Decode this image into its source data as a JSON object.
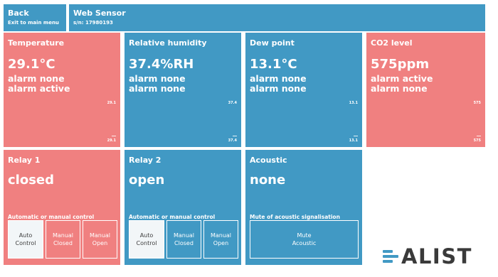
{
  "header": {
    "back_label": "Back",
    "back_sub": "Exit to main menu",
    "device_title": "Web Sensor",
    "serial": "s/n: 17980193"
  },
  "tiles": [
    {
      "title": "Temperature",
      "value": "29.1°C",
      "alarm1": "alarm none",
      "alarm2": "alarm active",
      "small_top": "29.1",
      "small_bottom": "29.1",
      "color": "#f08080"
    },
    {
      "title": "Relative humidity",
      "value": "37.4%RH",
      "alarm1": "alarm none",
      "alarm2": "alarm none",
      "small_top": "37.4",
      "small_bottom": "37.4",
      "color": "#4199c4"
    },
    {
      "title": "Dew point",
      "value": "13.1°C",
      "alarm1": "alarm none",
      "alarm2": "alarm none",
      "small_top": "13.1",
      "small_bottom": "13.1",
      "color": "#4199c4"
    },
    {
      "title": "CO2 level",
      "value": "575ppm",
      "alarm1": "alarm active",
      "alarm2": "alarm none",
      "small_top": "575",
      "small_bottom": "575",
      "color": "#f08080"
    }
  ],
  "relays": [
    {
      "title": "Relay 1",
      "state": "closed",
      "control_label": "Automatic or manual control",
      "buttons": [
        [
          "Auto",
          "Control"
        ],
        [
          "Manual",
          "Closed"
        ],
        [
          "Manual",
          "Open"
        ]
      ],
      "color": "#f08080"
    },
    {
      "title": "Relay 2",
      "state": "open",
      "control_label": "Automatic or manual control",
      "buttons": [
        [
          "Auto",
          "Control"
        ],
        [
          "Manual",
          "Closed"
        ],
        [
          "Manual",
          "Open"
        ]
      ],
      "color": "#4199c4"
    }
  ],
  "acoustic": {
    "title": "Acoustic",
    "state": "none",
    "control_label": "Mute of acoustic signalisation",
    "button": [
      "Mute",
      "Acoustic"
    ],
    "color": "#4199c4"
  },
  "logo": {
    "text": "ALIST",
    "icon": "comet-logo-icon",
    "color": "#4199c4"
  }
}
